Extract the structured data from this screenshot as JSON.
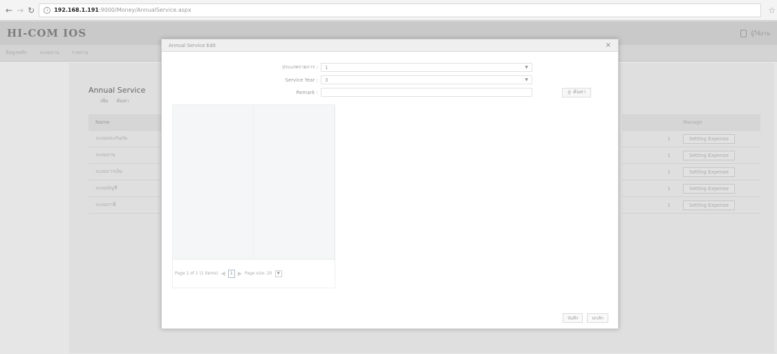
{
  "browser": {
    "url_host": "192.168.1.191",
    "url_path": ":9000/Money/AnnualService.aspx"
  },
  "app": {
    "brand": "HI-COM IOS",
    "user_label": "ผู้ใช้งาน",
    "menu": [
      "ข้อมูลหลัก",
      "ระบบงาน",
      "รายงาน"
    ],
    "page_title": "Annual Service",
    "sub_tabs": [
      "เพิ่ม",
      "ค้นหา"
    ],
    "table_header": "Name",
    "table_rows": [
      "ระบบประกันภัย",
      "ระบบงาน",
      "ระบบการเงิน",
      "ระบบบัญชี",
      "ระบบภาษี"
    ],
    "right_header": "Manage",
    "right_rows": [
      {
        "num": "1",
        "btn": "Setting Expense"
      },
      {
        "num": "1",
        "btn": "Setting Expense"
      },
      {
        "num": "1",
        "btn": "Setting Expense"
      },
      {
        "num": "1",
        "btn": "Setting Expense"
      },
      {
        "num": "1",
        "btn": "Setting Expense"
      }
    ]
  },
  "modal": {
    "title": "Annual Service Edit",
    "close_label": "×",
    "field1_label": "ประเภทรายการ :",
    "field1_value": "1",
    "field2_label": "Service Year :",
    "field2_value": "3",
    "field3_label": "Remark :",
    "field3_value": "",
    "search_label": "ค้นหา",
    "pager_text": "Page 1 of 1 (1 items)",
    "pager_page": "1",
    "page_size_text": "Page size: 20",
    "save_label": "บันทึก",
    "cancel_label": "ยกเลิก"
  }
}
